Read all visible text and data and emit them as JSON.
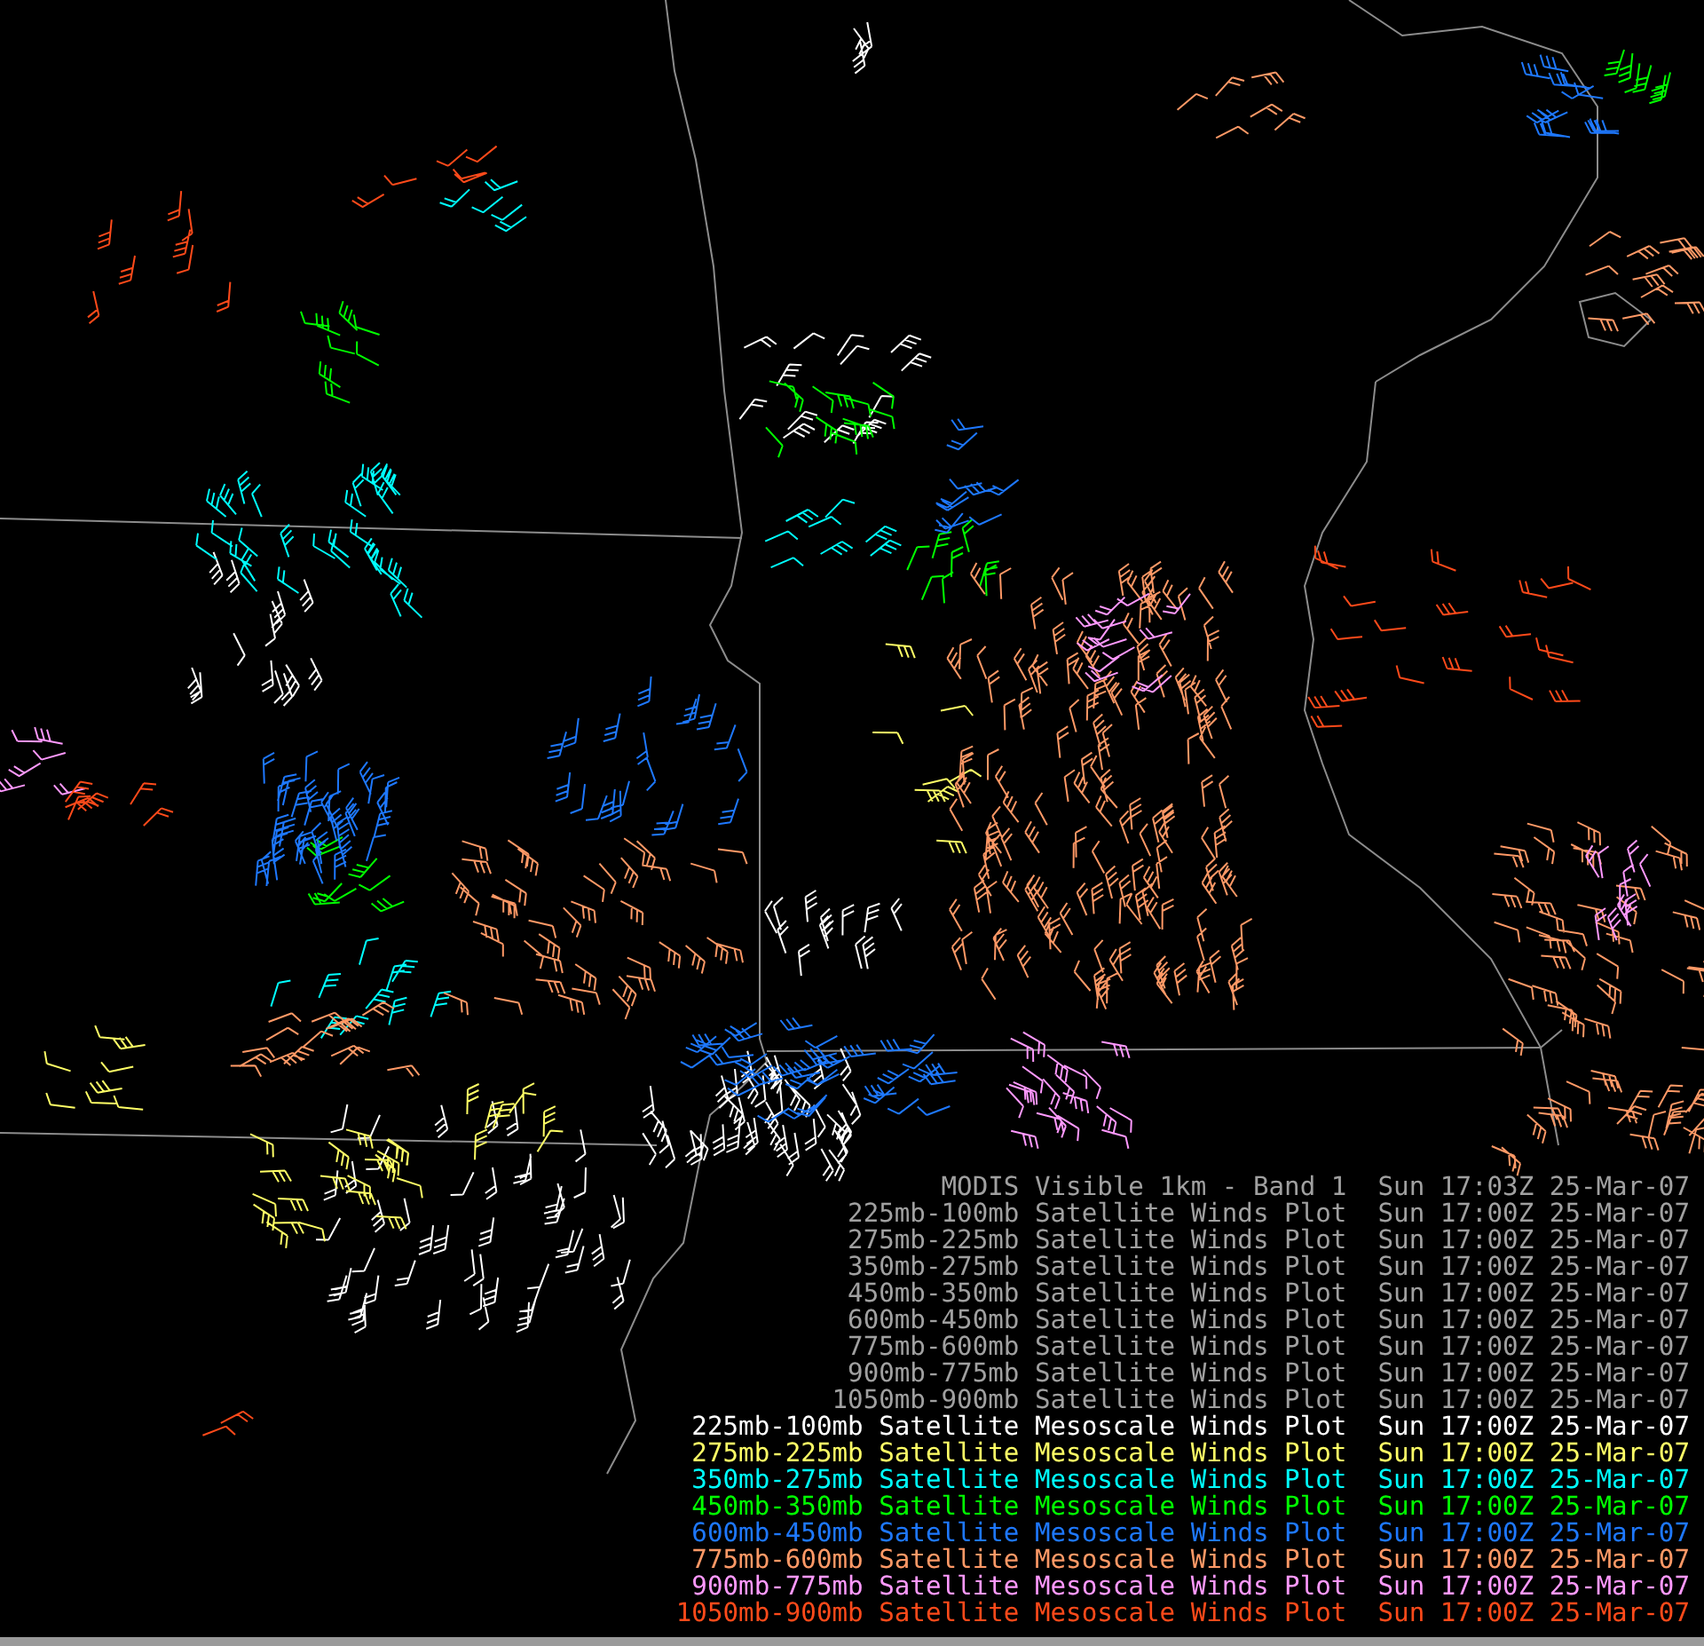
{
  "legend": [
    {
      "text": "MODIS Visible 1km - Band 1  Sun 17:03Z 25-Mar-07",
      "color": "#a0a0a0"
    },
    {
      "text": "225mb-100mb Satellite Winds Plot  Sun 17:00Z 25-Mar-07",
      "color": "#a0a0a0"
    },
    {
      "text": "275mb-225mb Satellite Winds Plot  Sun 17:00Z 25-Mar-07",
      "color": "#a0a0a0"
    },
    {
      "text": "350mb-275mb Satellite Winds Plot  Sun 17:00Z 25-Mar-07",
      "color": "#a0a0a0"
    },
    {
      "text": "450mb-350mb Satellite Winds Plot  Sun 17:00Z 25-Mar-07",
      "color": "#a0a0a0"
    },
    {
      "text": "600mb-450mb Satellite Winds Plot  Sun 17:00Z 25-Mar-07",
      "color": "#a0a0a0"
    },
    {
      "text": "775mb-600mb Satellite Winds Plot  Sun 17:00Z 25-Mar-07",
      "color": "#a0a0a0"
    },
    {
      "text": "900mb-775mb Satellite Winds Plot  Sun 17:00Z 25-Mar-07",
      "color": "#a0a0a0"
    },
    {
      "text": "1050mb-900mb Satellite Winds Plot  Sun 17:00Z 25-Mar-07",
      "color": "#a0a0a0"
    },
    {
      "text": "225mb-100mb Satellite Mesoscale Winds Plot  Sun 17:00Z 25-Mar-07",
      "color": "#ffffff"
    },
    {
      "text": "275mb-225mb Satellite Mesoscale Winds Plot  Sun 17:00Z 25-Mar-07",
      "color": "#ffff66"
    },
    {
      "text": "350mb-275mb Satellite Mesoscale Winds Plot  Sun 17:00Z 25-Mar-07",
      "color": "#00ffff"
    },
    {
      "text": "450mb-350mb Satellite Mesoscale Winds Plot  Sun 17:00Z 25-Mar-07",
      "color": "#00ff00"
    },
    {
      "text": "600mb-450mb Satellite Mesoscale Winds Plot  Sun 17:00Z 25-Mar-07",
      "color": "#1e78ff"
    },
    {
      "text": "775mb-600mb Satellite Mesoscale Winds Plot  Sun 17:00Z 25-Mar-07",
      "color": "#ff9966"
    },
    {
      "text": "900mb-775mb Satellite Mesoscale Winds Plot  Sun 17:00Z 25-Mar-07",
      "color": "#ff99ff"
    },
    {
      "text": "1050mb-900mb Satellite Mesoscale Winds Plot  Sun 17:00Z 25-Mar-07",
      "color": "#ff4a1a"
    }
  ]
}
